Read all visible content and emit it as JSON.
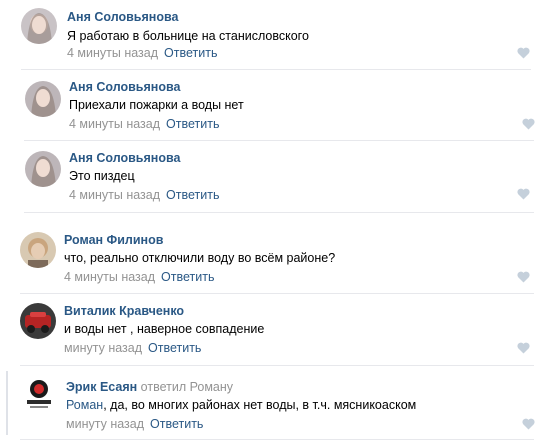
{
  "comments": [
    {
      "author": "Аня Соловьянова",
      "text": "Я работаю в больнице на станисловского",
      "time": "4 минуты назад",
      "reply": "Ответить"
    },
    {
      "author": "Аня Соловьянова",
      "text": "Приехали пожарки а воды нет",
      "time": "4 минуты назад",
      "reply": "Ответить"
    },
    {
      "author": "Аня Соловьянова",
      "text": "Это пиздец",
      "time": "4 минуты назад",
      "reply": "Ответить"
    },
    {
      "author": "Роман Филинов",
      "text": "что, реально отключили воду во всём районе?",
      "time": "4 минуты назад",
      "reply": "Ответить"
    },
    {
      "author": "Виталик Кравченко",
      "text": "и воды нет , наверное совпадение",
      "time": "минуту назад",
      "reply": "Ответить"
    },
    {
      "author": "Эрик Есаян",
      "replied_to": "ответил Роману",
      "mention": "Роман",
      "text": ", да, во многих районах нет воды, в т.ч. мясникоаском",
      "time": "минуту назад",
      "reply": "Ответить"
    }
  ],
  "colors": {
    "link": "#2a5885",
    "muted": "#939393",
    "divider": "#e7e8ec",
    "heart": "#c5d0db"
  },
  "icons": {
    "like": "heart-icon"
  }
}
